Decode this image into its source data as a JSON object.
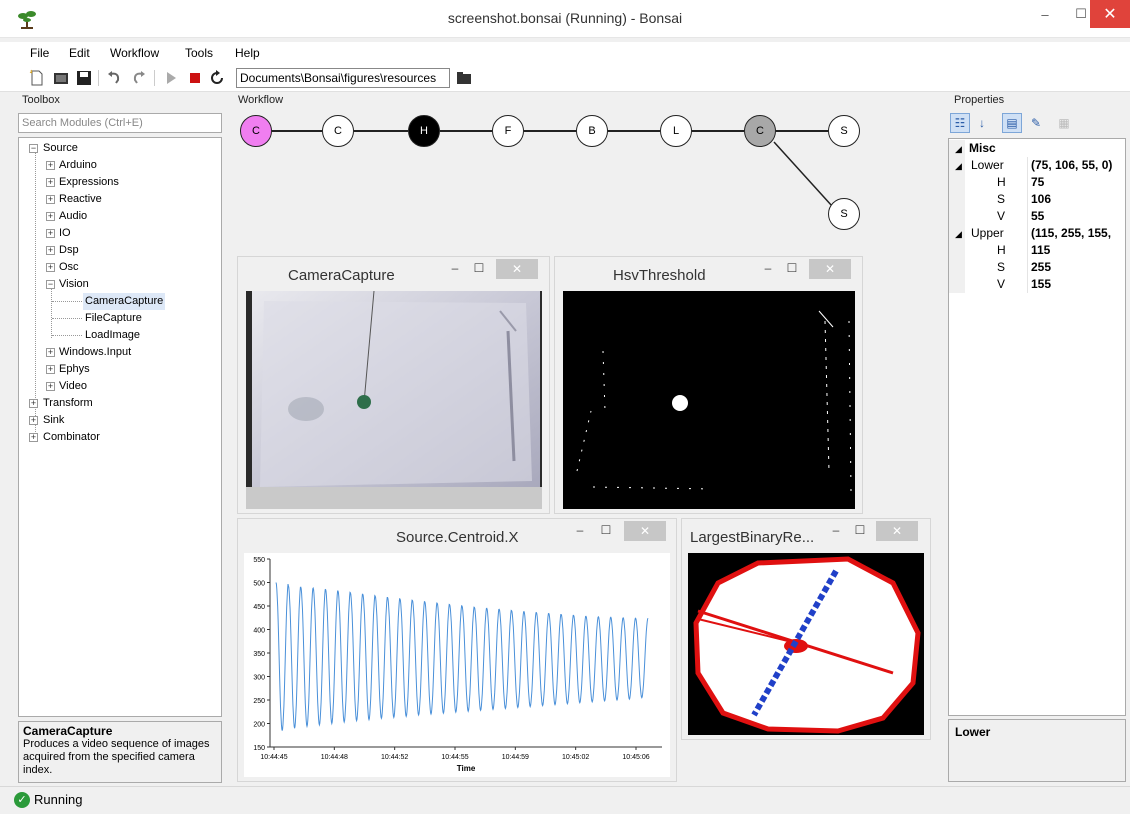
{
  "window": {
    "title": "screenshot.bonsai (Running) - Bonsai",
    "minimize": "–",
    "maximize": "☐",
    "close": "✕"
  },
  "menu": [
    {
      "label": "File"
    },
    {
      "label": "Edit"
    },
    {
      "label": "Workflow"
    },
    {
      "label": "Tools"
    },
    {
      "label": "Help"
    }
  ],
  "toolbar": {
    "path": "Documents\\Bonsai\\figures\\resources"
  },
  "toolbox": {
    "label": "Toolbox",
    "search_placeholder": "Search Modules (Ctrl+E)",
    "tree": [
      {
        "text": "Source",
        "exp": "−"
      },
      {
        "text": "Arduino",
        "exp": "+"
      },
      {
        "text": "Expressions",
        "exp": "+"
      },
      {
        "text": "Reactive",
        "exp": "+"
      },
      {
        "text": "Audio",
        "exp": "+"
      },
      {
        "text": "IO",
        "exp": "+"
      },
      {
        "text": "Dsp",
        "exp": "+"
      },
      {
        "text": "Osc",
        "exp": "+"
      },
      {
        "text": "Vision",
        "exp": "−"
      },
      {
        "text": "CameraCapture",
        "exp": ""
      },
      {
        "text": "FileCapture",
        "exp": ""
      },
      {
        "text": "LoadImage",
        "exp": ""
      },
      {
        "text": "Windows.Input",
        "exp": "+"
      },
      {
        "text": "Ephys",
        "exp": "+"
      },
      {
        "text": "Video",
        "exp": "+"
      },
      {
        "text": "Transform",
        "exp": "+"
      },
      {
        "text": "Sink",
        "exp": "+"
      },
      {
        "text": "Combinator",
        "exp": "+"
      }
    ],
    "description_title": "CameraCapture",
    "description": "Produces a video sequence of images acquired from the specified camera index."
  },
  "workflow": {
    "label": "Workflow",
    "nodes": [
      "C",
      "C",
      "H",
      "F",
      "B",
      "L",
      "C",
      "S",
      "S"
    ],
    "colors": {
      "selected": "#f07ef0",
      "running": "#000000",
      "disabled": "#a8a8a8"
    }
  },
  "visualizers": {
    "camera": {
      "title": "CameraCapture"
    },
    "hsv": {
      "title": "HsvThreshold"
    },
    "centroid": {
      "title": "Source.Centroid.X"
    },
    "binary": {
      "title": "LargestBinaryRe..."
    },
    "min": "–",
    "max": "☐",
    "close": "✕"
  },
  "chart_data": {
    "type": "line",
    "title": "",
    "xlabel": "Time",
    "ylabel": "",
    "ylim": [
      150,
      550
    ],
    "yticks": [
      550,
      500,
      450,
      400,
      350,
      300,
      250,
      200,
      150
    ],
    "xticks": [
      "10:44:45",
      "10:44:48",
      "10:44:52",
      "10:44:55",
      "10:44:59",
      "10:45:02",
      "10:45:06"
    ],
    "series": [
      {
        "color": "#4a90d9",
        "cycles": 30,
        "peaks": [
          500,
          493,
          490,
          488,
          485,
          482,
          478,
          475,
          471,
          468,
          465,
          462,
          459,
          456,
          453,
          450,
          447,
          445,
          443,
          440,
          438,
          436,
          434,
          432,
          430,
          428,
          427,
          426,
          425,
          424
        ],
        "troughs": [
          185,
          190,
          194,
          197,
          200,
          203,
          206,
          208,
          211,
          213,
          215,
          218,
          220,
          222,
          224,
          226,
          228,
          230,
          232,
          234,
          236,
          238,
          240,
          242,
          244,
          246,
          248,
          250,
          252,
          255
        ]
      }
    ]
  },
  "properties": {
    "label": "Properties",
    "rows": [
      {
        "name": "Misc",
        "value": "",
        "category": true
      },
      {
        "name": "Lower",
        "value": "(75, 106, 55, 0)",
        "expand": "◢"
      },
      {
        "name": "H",
        "value": "75"
      },
      {
        "name": "S",
        "value": "106"
      },
      {
        "name": "V",
        "value": "55"
      },
      {
        "name": "Upper",
        "value": "(115, 255, 155,",
        "expand": "◢"
      },
      {
        "name": "H",
        "value": "115"
      },
      {
        "name": "S",
        "value": "255"
      },
      {
        "name": "V",
        "value": "155"
      }
    ],
    "description_title": "Lower"
  },
  "status": {
    "text": "Running",
    "icon_char": "✓"
  }
}
